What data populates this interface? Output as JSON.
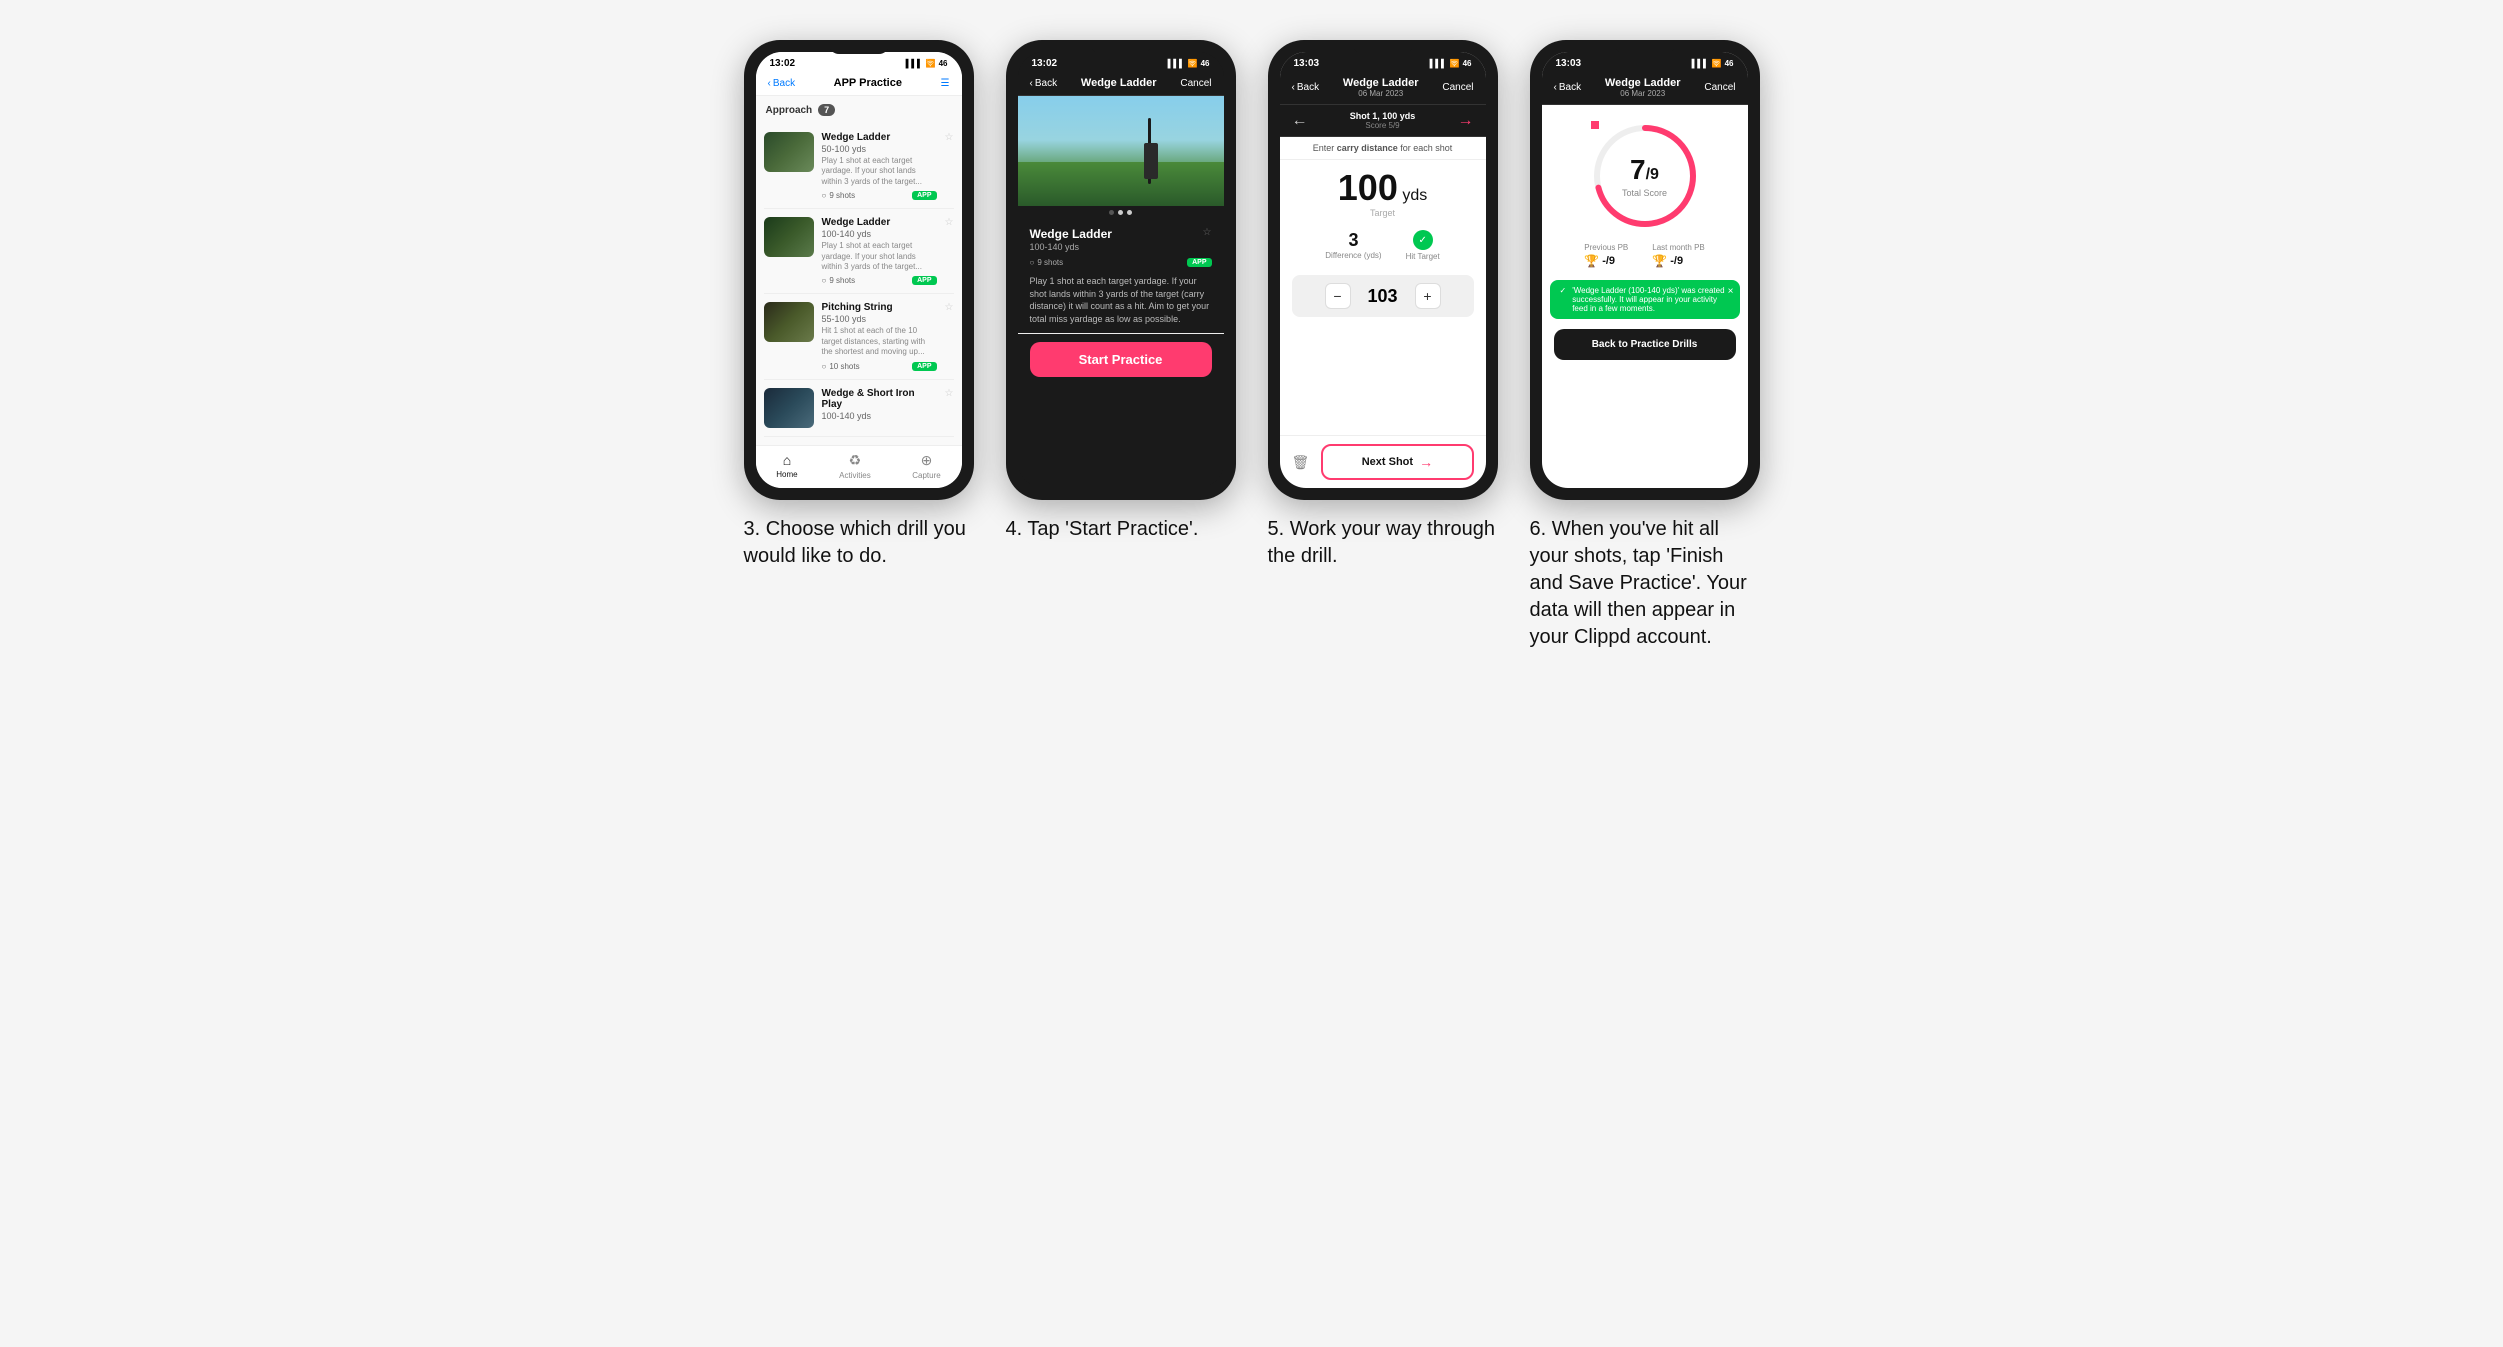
{
  "screens": [
    {
      "id": "screen3",
      "status_time": "13:02",
      "nav_back": "Back",
      "nav_title": "APP Practice",
      "nav_menu": "☰",
      "category": "Approach",
      "category_count": "7",
      "drills": [
        {
          "name": "Wedge Ladder",
          "yds": "50-100 yds",
          "desc": "Play 1 shot at each target yardage. If your shot lands within 3 yards of the target...",
          "shots": "9 shots",
          "badge": "APP"
        },
        {
          "name": "Wedge Ladder",
          "yds": "100-140 yds",
          "desc": "Play 1 shot at each target yardage. If your shot lands within 3 yards of the target...",
          "shots": "9 shots",
          "badge": "APP"
        },
        {
          "name": "Pitching String",
          "yds": "55-100 yds",
          "desc": "Hit 1 shot at each of the 10 target distances, starting with the shortest and moving up...",
          "shots": "10 shots",
          "badge": "APP"
        },
        {
          "name": "Wedge & Short Iron Play",
          "yds": "100-140 yds",
          "desc": "",
          "shots": "",
          "badge": ""
        }
      ],
      "tabs": [
        "Home",
        "Activities",
        "Capture"
      ]
    },
    {
      "id": "screen4",
      "status_time": "13:02",
      "nav_back": "Back",
      "nav_title": "Wedge Ladder",
      "nav_cancel": "Cancel",
      "drill_name": "Wedge Ladder",
      "drill_yds": "100-140 yds",
      "drill_shots": "9 shots",
      "drill_badge": "APP",
      "drill_desc": "Play 1 shot at each target yardage. If your shot lands within 3 yards of the target (carry distance) it will count as a hit. Aim to get your total miss yardage as low as possible.",
      "start_btn": "Start Practice"
    },
    {
      "id": "screen5",
      "status_time": "13:03",
      "nav_back": "Back",
      "nav_title_top": "Wedge Ladder",
      "nav_title_sub": "06 Mar 2023",
      "nav_cancel": "Cancel",
      "shot_label": "Shot 1, 100 yds",
      "shot_score": "Score 5/9",
      "carry_instruction": "Enter carry distance for each shot",
      "target_yds": "100",
      "target_unit": "yds",
      "target_label": "Target",
      "difference": "3",
      "difference_label": "Difference (yds)",
      "hit_target": "Hit Target",
      "stepper_value": "103",
      "next_shot_label": "Next Shot"
    },
    {
      "id": "screen6",
      "status_time": "13:03",
      "nav_back": "Back",
      "nav_title_top": "Wedge Ladder",
      "nav_title_sub": "06 Mar 2023",
      "nav_cancel": "Cancel",
      "score_number": "7",
      "score_denom": "/9",
      "total_score_label": "Total Score",
      "previous_pb_label": "Previous PB",
      "previous_pb_value": "-/9",
      "last_month_pb_label": "Last month PB",
      "last_month_pb_value": "-/9",
      "toast_message": "'Wedge Ladder (100-140 yds)' was created successfully. It will appear in your activity feed in a few moments.",
      "back_btn": "Back to Practice Drills"
    }
  ],
  "captions": [
    "3. Choose which drill you would like to do.",
    "4. Tap 'Start Practice'.",
    "5. Work your way through the drill.",
    "6. When you've hit all your shots, tap 'Finish and Save Practice'. Your data will then appear in your Clippd account."
  ]
}
